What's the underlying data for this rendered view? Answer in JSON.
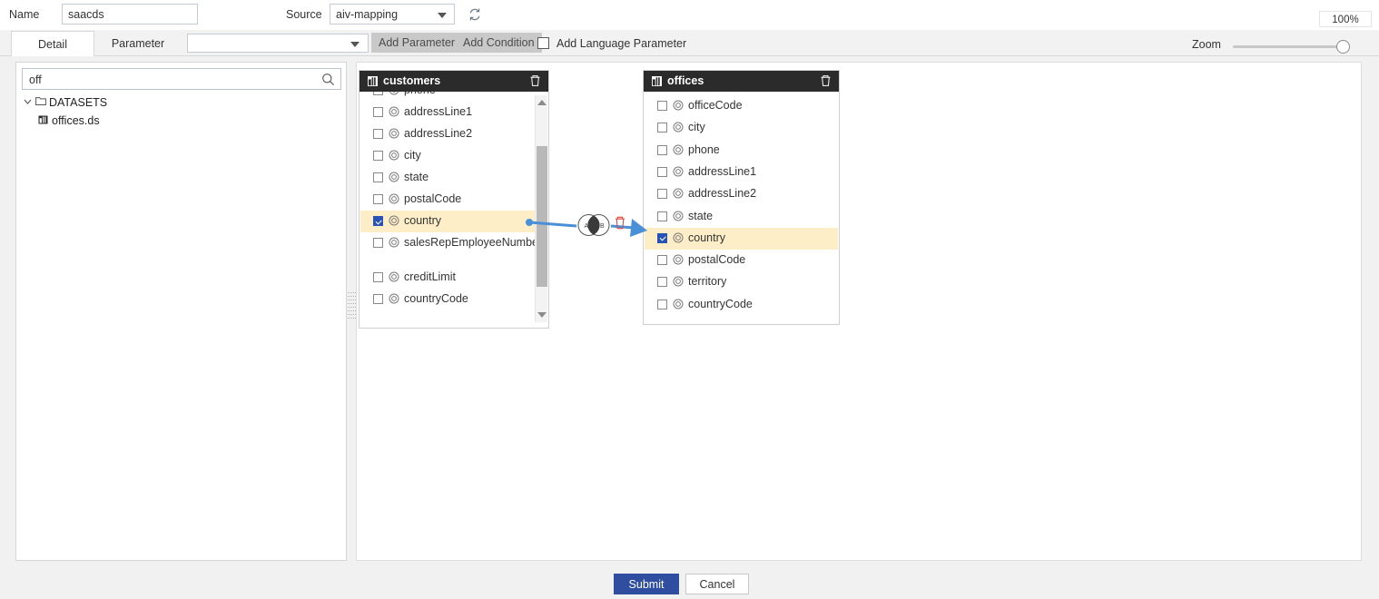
{
  "header": {
    "name_label": "Name",
    "name_value": "saacds",
    "source_label": "Source",
    "source_value": "aiv-mapping",
    "refresh_icon": "refresh-icon",
    "zoom_badge": "100%"
  },
  "toolbar": {
    "tabs": [
      {
        "label": "Detail",
        "active": true
      },
      {
        "label": "Parameter",
        "active": false
      }
    ],
    "parameter_select_value": "",
    "add_parameter_label": "Add Parameter",
    "add_condition_label": "Add Condition",
    "add_language_parameter_label": "Add Language Parameter",
    "add_language_parameter_checked": false,
    "zoom_label": "Zoom",
    "zoom_value": "100%"
  },
  "left_panel": {
    "search": {
      "value": "off",
      "placeholder": "",
      "icon": "search-icon"
    },
    "tree": {
      "root": {
        "label": "DATASETS",
        "expanded": true,
        "icon": "folder-icon"
      },
      "children": [
        {
          "label": "offices.ds",
          "icon": "dataset-icon"
        }
      ]
    }
  },
  "canvas": {
    "cards": [
      {
        "title": "customers",
        "icon": "table-icon",
        "delete_icon": "trash-icon",
        "scrolled": true,
        "fields": [
          {
            "name": "phone",
            "checked": false,
            "selected": false
          },
          {
            "name": "addressLine1",
            "checked": false,
            "selected": false
          },
          {
            "name": "addressLine2",
            "checked": false,
            "selected": false
          },
          {
            "name": "city",
            "checked": false,
            "selected": false
          },
          {
            "name": "state",
            "checked": false,
            "selected": false
          },
          {
            "name": "postalCode",
            "checked": false,
            "selected": false
          },
          {
            "name": "country",
            "checked": true,
            "selected": true
          },
          {
            "name": "salesRepEmployeeNumber",
            "checked": false,
            "selected": false
          },
          {
            "name": "creditLimit",
            "checked": false,
            "selected": false
          },
          {
            "name": "countryCode",
            "checked": false,
            "selected": false
          }
        ]
      },
      {
        "title": "offices",
        "icon": "table-icon",
        "delete_icon": "trash-icon",
        "scrolled": false,
        "fields": [
          {
            "name": "officeCode",
            "checked": false,
            "selected": false
          },
          {
            "name": "city",
            "checked": false,
            "selected": false
          },
          {
            "name": "phone",
            "checked": false,
            "selected": false
          },
          {
            "name": "addressLine1",
            "checked": false,
            "selected": false
          },
          {
            "name": "addressLine2",
            "checked": false,
            "selected": false
          },
          {
            "name": "state",
            "checked": false,
            "selected": false
          },
          {
            "name": "country",
            "checked": true,
            "selected": true
          },
          {
            "name": "postalCode",
            "checked": false,
            "selected": false
          },
          {
            "name": "territory",
            "checked": false,
            "selected": false
          },
          {
            "name": "countryCode",
            "checked": false,
            "selected": false
          }
        ]
      }
    ],
    "join": {
      "type_icon": "inner-join-venn-icon",
      "left_label": "A",
      "right_label": "B",
      "delete_icon": "join-delete-trash-icon",
      "line_color": "#4a90d9"
    }
  },
  "footer": {
    "submit_label": "Submit",
    "cancel_label": "Cancel"
  },
  "colors": {
    "accent": "#2f4ea0",
    "selected_row": "#fdeec8",
    "checkbox_on": "#2753b8",
    "join_line": "#4a90d9",
    "card_header": "#2b2b2b"
  }
}
